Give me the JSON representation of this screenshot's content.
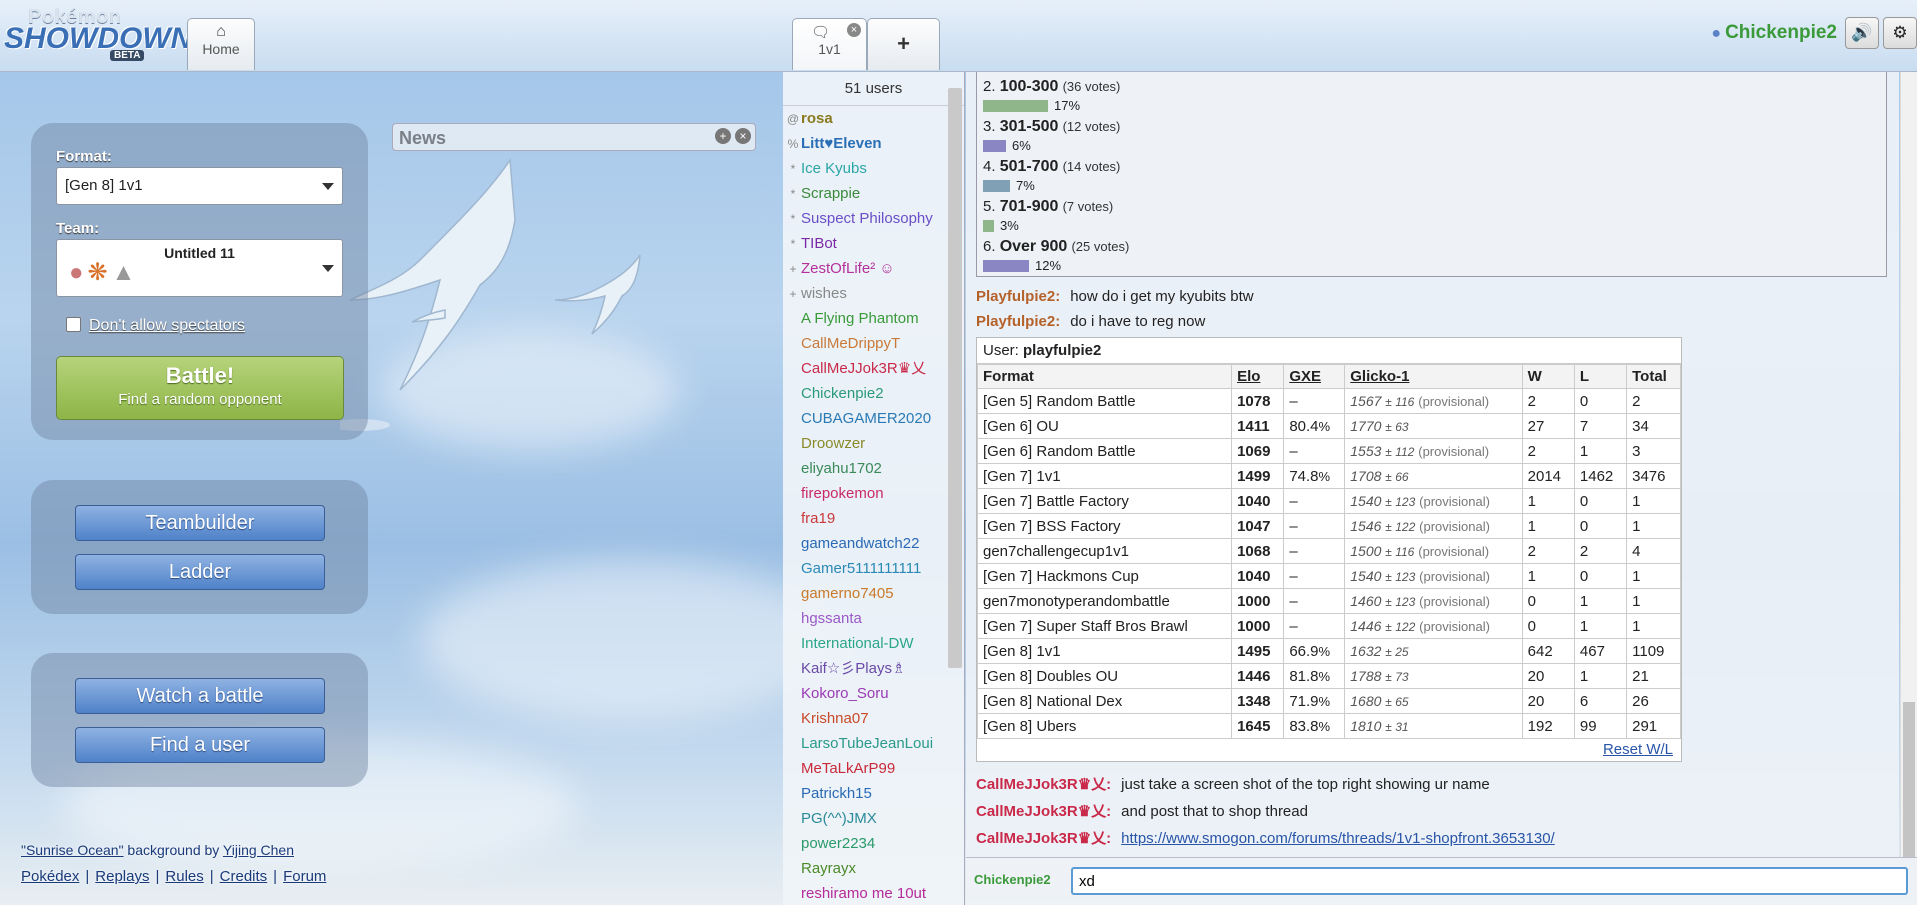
{
  "header": {
    "logo": {
      "line1": "Pokémon",
      "line2": "SHOWDOWN",
      "line3": "BETA"
    },
    "tabs": [
      {
        "label": "Home",
        "icon": "home-icon"
      },
      {
        "label": "1v1",
        "icon": "chat-bubble-icon"
      }
    ],
    "new_tab_label": "+",
    "username": "Chickenpie2"
  },
  "menu": {
    "format_label": "Format:",
    "format_value": "[Gen 8] 1v1",
    "team_label": "Team:",
    "team_name": "Untitled 11",
    "spectators_label": "Don't allow spectators",
    "battle_title": "Battle!",
    "battle_subtitle": "Find a random opponent",
    "teambuilder": "Teambuilder",
    "ladder": "Ladder",
    "watch": "Watch a battle",
    "find_user": "Find a user",
    "bg_credit_name": "\"Sunrise Ocean\"",
    "bg_credit_by": " background by ",
    "bg_credit_artist": "Yijing Chen",
    "footer_links": [
      "Pokédex",
      "Replays",
      "Rules",
      "Credits",
      "Forum"
    ]
  },
  "news": {
    "title": "News"
  },
  "userlist": {
    "count": "51 users",
    "users": [
      {
        "group": "@",
        "name": "rosa",
        "color": "#8a7a20",
        "bold": true
      },
      {
        "group": "%",
        "name": "Litt♥Eleven",
        "color": "#2a6fb5",
        "bold": true
      },
      {
        "group": "*",
        "name": "Ice Kyubs",
        "color": "#2aa6a6"
      },
      {
        "group": "*",
        "name": "Scrappie",
        "color": "#3a8a3a"
      },
      {
        "group": "*",
        "name": "Suspect Philosophy",
        "color": "#6a4fc9"
      },
      {
        "group": "*",
        "name": "TIBot",
        "color": "#7a2aa6"
      },
      {
        "group": "+",
        "name": "ZestOfLife² ☺",
        "color": "#b5309a"
      },
      {
        "group": "+",
        "name": "wishes",
        "color": "#888888"
      },
      {
        "group": "",
        "name": "A Flying Phantom",
        "color": "#3a9a3a"
      },
      {
        "group": "",
        "name": "CallMeDrippyT",
        "color": "#c97a3a"
      },
      {
        "group": "",
        "name": "CallMeJJok3R♛乂",
        "color": "#c92a4a"
      },
      {
        "group": "",
        "name": "Chickenpie2",
        "color": "#2a9a7a"
      },
      {
        "group": "",
        "name": "CUBAGAMER2020",
        "color": "#2a7ab5"
      },
      {
        "group": "",
        "name": "Droowzer",
        "color": "#8a8a2a"
      },
      {
        "group": "",
        "name": "eliyahu1702",
        "color": "#3a8a5a"
      },
      {
        "group": "",
        "name": "firepokemon",
        "color": "#c92a6a"
      },
      {
        "group": "",
        "name": "fra19",
        "color": "#c93a3a"
      },
      {
        "group": "",
        "name": "gameandwatch22",
        "color": "#2a6ab5"
      },
      {
        "group": "",
        "name": "Gamer5111111111",
        "color": "#2a8ab5"
      },
      {
        "group": "",
        "name": "gamerno7405",
        "color": "#c97a2a"
      },
      {
        "group": "",
        "name": "hgssanta",
        "color": "#9a5ac9"
      },
      {
        "group": "",
        "name": "International-DW",
        "color": "#2aa68a"
      },
      {
        "group": "",
        "name": "Kaif☆彡Plays♗",
        "color": "#6a4aa6"
      },
      {
        "group": "",
        "name": "Kokoro_Soru",
        "color": "#9a3ab5"
      },
      {
        "group": "",
        "name": "Krishna07",
        "color": "#c94a2a"
      },
      {
        "group": "",
        "name": "LarsoTubeJeanLoui",
        "color": "#2a9a8a"
      },
      {
        "group": "",
        "name": "MeTaLkArP99",
        "color": "#c92a3a"
      },
      {
        "group": "",
        "name": "Patrickh15",
        "color": "#2a6ab5"
      },
      {
        "group": "",
        "name": "PG(^^)JMX",
        "color": "#2a8a9a"
      },
      {
        "group": "",
        "name": "power2234",
        "color": "#2a9a6a"
      },
      {
        "group": "",
        "name": "Rayrayx",
        "color": "#4a8a2a"
      },
      {
        "group": "",
        "name": "reshiramo me 10ut",
        "color": "#b52a9a"
      }
    ]
  },
  "poll": {
    "options": [
      {
        "num": "2.",
        "label": "100-300",
        "votes": "(36 votes)",
        "pct": "17%",
        "fraction": 0.17,
        "color": "#8fb58a"
      },
      {
        "num": "3.",
        "label": "301-500",
        "votes": "(12 votes)",
        "pct": "6%",
        "fraction": 0.06,
        "color": "#8a86c4"
      },
      {
        "num": "4.",
        "label": "501-700",
        "votes": "(14 votes)",
        "pct": "7%",
        "fraction": 0.07,
        "color": "#7fa0b5"
      },
      {
        "num": "5.",
        "label": "701-900",
        "votes": "(7 votes)",
        "pct": "3%",
        "fraction": 0.03,
        "color": "#8fb58a"
      },
      {
        "num": "6.",
        "label": "Over 900",
        "votes": "(25 votes)",
        "pct": "12%",
        "fraction": 0.12,
        "color": "#8a86c4"
      }
    ]
  },
  "chat": {
    "messages_top": [
      {
        "user": "Playfulpie2:",
        "text": "how do i get my kyubits btw",
        "color": "#b5622a"
      },
      {
        "user": "Playfulpie2:",
        "text": "do i have to reg now",
        "color": "#b5622a"
      }
    ],
    "rank_user_label": "User: ",
    "rank_user": "playfulpie2",
    "rank_headers": [
      "Format",
      "Elo",
      "GXE",
      "Glicko-1",
      "W",
      "L",
      "Total"
    ],
    "rank_rows": [
      {
        "format": "[Gen 5] Random Battle",
        "elo": "1078",
        "gxe": "–",
        "gxe_pct": "",
        "glicko": "1567",
        "dev": "± 116",
        "prov": "(provisional)",
        "w": "2",
        "l": "0",
        "total": "2"
      },
      {
        "format": "[Gen 6] OU",
        "elo": "1411",
        "gxe": "80.4",
        "gxe_pct": "%",
        "glicko": "1770",
        "dev": "± 63",
        "prov": "",
        "w": "27",
        "l": "7",
        "total": "34"
      },
      {
        "format": "[Gen 6] Random Battle",
        "elo": "1069",
        "gxe": "–",
        "gxe_pct": "",
        "glicko": "1553",
        "dev": "± 112",
        "prov": "(provisional)",
        "w": "2",
        "l": "1",
        "total": "3"
      },
      {
        "format": "[Gen 7] 1v1",
        "elo": "1499",
        "gxe": "74.8",
        "gxe_pct": "%",
        "glicko": "1708",
        "dev": "± 66",
        "prov": "",
        "w": "2014",
        "l": "1462",
        "total": "3476"
      },
      {
        "format": "[Gen 7] Battle Factory",
        "elo": "1040",
        "gxe": "–",
        "gxe_pct": "",
        "glicko": "1540",
        "dev": "± 123",
        "prov": "(provisional)",
        "w": "1",
        "l": "0",
        "total": "1"
      },
      {
        "format": "[Gen 7] BSS Factory",
        "elo": "1047",
        "gxe": "–",
        "gxe_pct": "",
        "glicko": "1546",
        "dev": "± 122",
        "prov": "(provisional)",
        "w": "1",
        "l": "0",
        "total": "1"
      },
      {
        "format": "gen7challengecup1v1",
        "elo": "1068",
        "gxe": "–",
        "gxe_pct": "",
        "glicko": "1500",
        "dev": "± 116",
        "prov": "(provisional)",
        "w": "2",
        "l": "2",
        "total": "4"
      },
      {
        "format": "[Gen 7] Hackmons Cup",
        "elo": "1040",
        "gxe": "–",
        "gxe_pct": "",
        "glicko": "1540",
        "dev": "± 123",
        "prov": "(provisional)",
        "w": "1",
        "l": "0",
        "total": "1"
      },
      {
        "format": "gen7monotyperandombattle",
        "elo": "1000",
        "gxe": "–",
        "gxe_pct": "",
        "glicko": "1460",
        "dev": "± 123",
        "prov": "(provisional)",
        "w": "0",
        "l": "1",
        "total": "1"
      },
      {
        "format": "[Gen 7] Super Staff Bros Brawl",
        "elo": "1000",
        "gxe": "–",
        "gxe_pct": "",
        "glicko": "1446",
        "dev": "± 122",
        "prov": "(provisional)",
        "w": "0",
        "l": "1",
        "total": "1"
      },
      {
        "format": "[Gen 8] 1v1",
        "elo": "1495",
        "gxe": "66.9",
        "gxe_pct": "%",
        "glicko": "1632",
        "dev": "± 25",
        "prov": "",
        "w": "642",
        "l": "467",
        "total": "1109"
      },
      {
        "format": "[Gen 8] Doubles OU",
        "elo": "1446",
        "gxe": "81.8",
        "gxe_pct": "%",
        "glicko": "1788",
        "dev": "± 73",
        "prov": "",
        "w": "20",
        "l": "1",
        "total": "21"
      },
      {
        "format": "[Gen 8] National Dex",
        "elo": "1348",
        "gxe": "71.9",
        "gxe_pct": "%",
        "glicko": "1680",
        "dev": "± 65",
        "prov": "",
        "w": "20",
        "l": "6",
        "total": "26"
      },
      {
        "format": "[Gen 8] Ubers",
        "elo": "1645",
        "gxe": "83.8",
        "gxe_pct": "%",
        "glicko": "1810",
        "dev": "± 31",
        "prov": "",
        "w": "192",
        "l": "99",
        "total": "291"
      }
    ],
    "reset_wl": "Reset W/L",
    "messages_bottom": [
      {
        "user": "CallMeJJok3R♛乂:",
        "text": "just take a screen shot of the top right showing ur name",
        "color": "#c92a4a"
      },
      {
        "user": "CallMeJJok3R♛乂:",
        "text": "and post that to shop thread",
        "color": "#c92a4a"
      },
      {
        "user": "CallMeJJok3R♛乂:",
        "text": "https://www.smogon.com/forums/threads/1v1-shopfront.3653130/",
        "color": "#c92a4a",
        "is_link": true
      }
    ]
  },
  "composer": {
    "me": "Chickenpie2",
    "value": "xd"
  }
}
